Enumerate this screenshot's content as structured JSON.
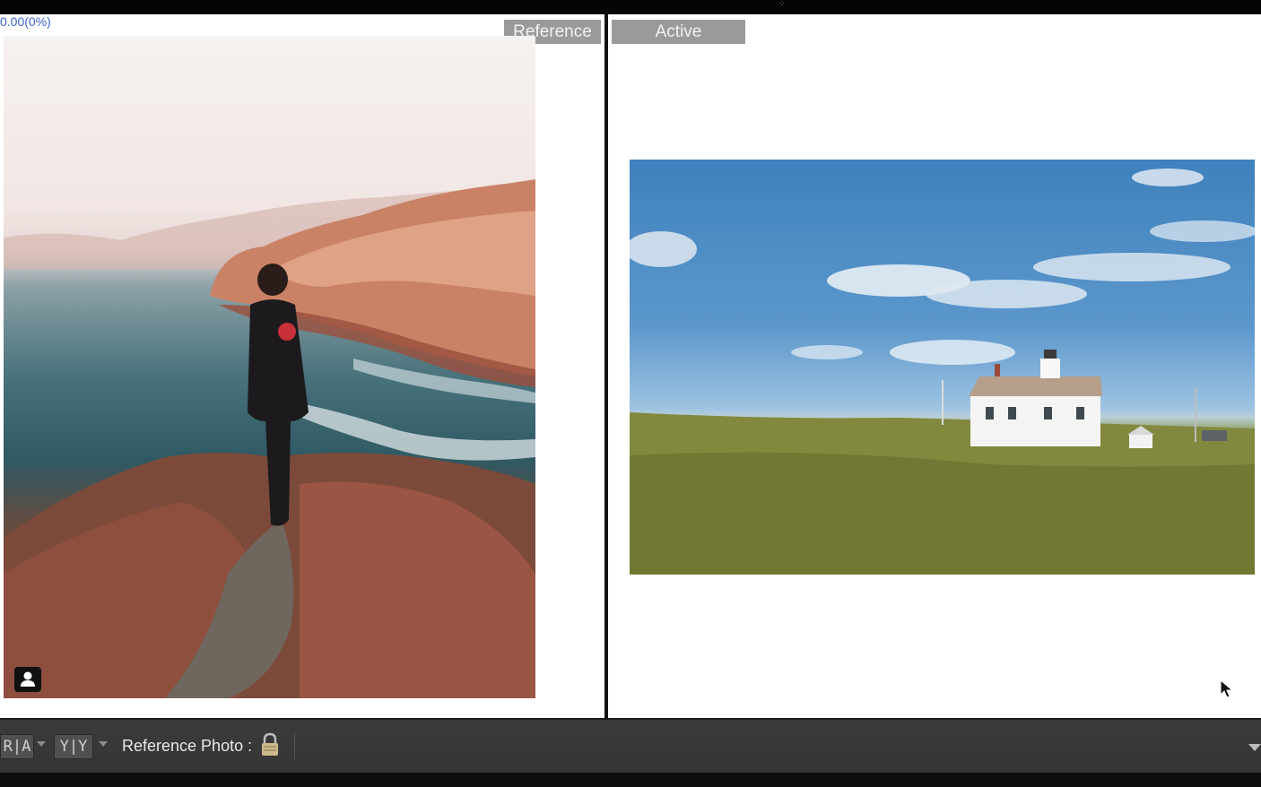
{
  "compare": {
    "readout": "0.00(0%)",
    "reference_tab": "Reference",
    "active_tab": "Active"
  },
  "toolbar": {
    "view_ra": "R|A",
    "view_yy": "Y|Y",
    "reference_photo_label": "Reference Photo :"
  },
  "icons": {
    "portrait": "person-icon",
    "lock": "lock-icon",
    "cursor": "mouse-pointer-icon",
    "dropdown": "chevron-down-icon"
  }
}
